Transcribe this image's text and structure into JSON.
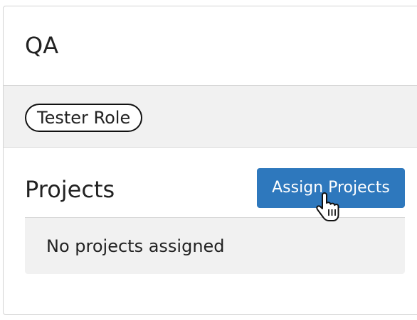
{
  "group": {
    "title": "QA"
  },
  "role": {
    "label": "Tester Role"
  },
  "projects": {
    "heading": "Projects",
    "assign_button_label": "Assign Projects",
    "empty_message": "No projects assigned"
  },
  "colors": {
    "primary_button": "#2e78bd",
    "band_background": "#f1f1f1",
    "border": "#d8d8d8"
  },
  "cursor": {
    "icon": "hand-pointer-icon"
  }
}
